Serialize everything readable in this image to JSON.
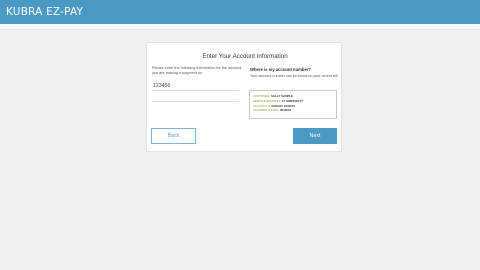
{
  "header": {
    "logo_text": "KUBRA EZ-PAY",
    "brand_color": "#4a9ac5"
  },
  "form": {
    "title": "Enter Your Account Information",
    "instructions": "Please enter the following information for the account you are making a payment on:",
    "account_number_value": "123456"
  },
  "help": {
    "title": "Where is my account number?",
    "text": "Your account number can be found on your recent bill.",
    "sample_bill": [
      {
        "label": "CUSTOMER:",
        "value": "SALLY SAMPLE"
      },
      {
        "label": "SERVICE ADDRESS:",
        "value": "12 HOBSON ST"
      },
      {
        "label": "ACCOUNT #:",
        "value": "XXXXXX XXXXXX"
      },
      {
        "label": "STATEMENT DATE:",
        "value": "06/06/16"
      }
    ]
  },
  "buttons": {
    "back_label": "Back",
    "next_label": "Next"
  }
}
